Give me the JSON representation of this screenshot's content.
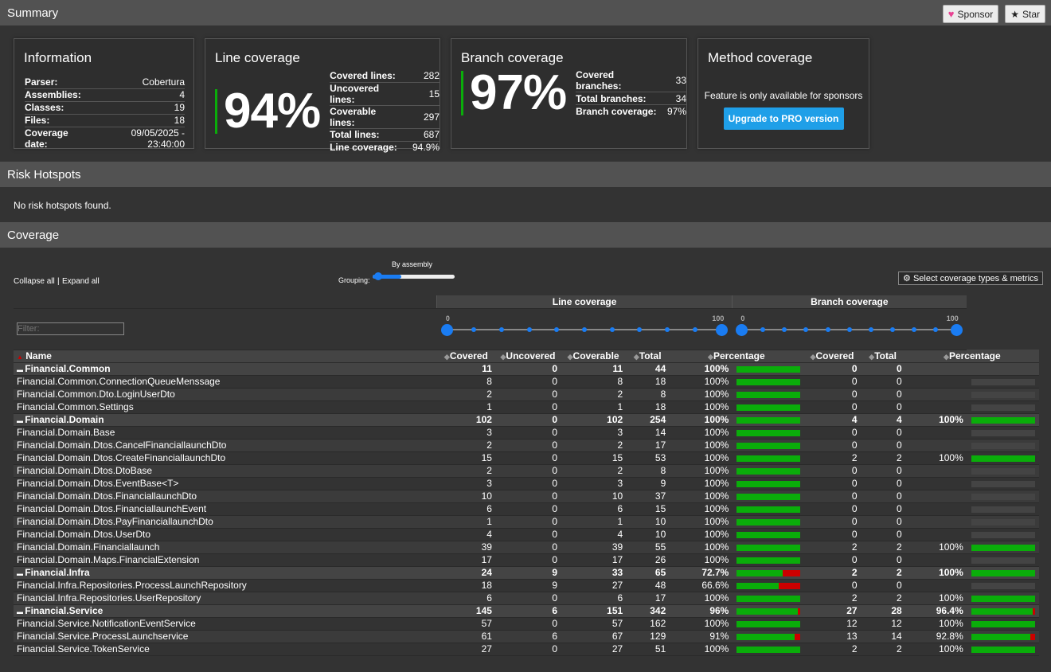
{
  "header": {
    "title": "Summary",
    "sponsor": "Sponsor",
    "star": "Star"
  },
  "information": {
    "title": "Information",
    "rows": [
      {
        "k": "Parser:",
        "v": "Cobertura"
      },
      {
        "k": "Assemblies:",
        "v": "4"
      },
      {
        "k": "Classes:",
        "v": "19"
      },
      {
        "k": "Files:",
        "v": "18"
      },
      {
        "k": "Coverage date:",
        "v": "09/05/2025 - 23:40:00"
      }
    ]
  },
  "line": {
    "title": "Line coverage",
    "pct": "94%",
    "rows": [
      {
        "k": "Covered lines:",
        "v": "282"
      },
      {
        "k": "Uncovered lines:",
        "v": "15"
      },
      {
        "k": "Coverable lines:",
        "v": "297"
      },
      {
        "k": "Total lines:",
        "v": "687"
      },
      {
        "k": "Line coverage:",
        "v": "94.9%"
      }
    ]
  },
  "branch": {
    "title": "Branch coverage",
    "pct": "97%",
    "rows": [
      {
        "k": "Covered branches:",
        "v": "33"
      },
      {
        "k": "Total branches:",
        "v": "34"
      },
      {
        "k": "Branch coverage:",
        "v": "97%"
      }
    ]
  },
  "method": {
    "title": "Method coverage",
    "text": "Feature is only available for sponsors",
    "button": "Upgrade to PRO version"
  },
  "risk": {
    "title": "Risk Hotspots",
    "text": "No risk hotspots found."
  },
  "coverage": {
    "title": "Coverage",
    "collapse": "Collapse all",
    "sep": "|",
    "expand": "Expand all",
    "grouping_label": "Grouping:",
    "grouping_value": "By assembly",
    "select": "Select coverage types & metrics",
    "filter_placeholder": "Filter:",
    "line_header": "Line coverage",
    "branch_header": "Branch coverage",
    "slider_min": "0",
    "slider_max": "100",
    "cols": {
      "name": "Name",
      "covered": "Covered",
      "uncovered": "Uncovered",
      "coverable": "Coverable",
      "total": "Total",
      "percentage": "Percentage",
      "bcovered": "Covered",
      "btotal": "Total",
      "bpercentage": "Percentage"
    }
  },
  "rows": [
    {
      "g": true,
      "n": "Financial.Common",
      "cv": "11",
      "un": "0",
      "ca": "11",
      "t": "44",
      "p": "100%",
      "lp": 100,
      "bc": "0",
      "bt": "0",
      "bp": "",
      "bpv": null
    },
    {
      "n": "Financial.Common.ConnectionQueueMenssage",
      "cv": "8",
      "un": "0",
      "ca": "8",
      "t": "18",
      "p": "100%",
      "lp": 100,
      "bc": "0",
      "bt": "0",
      "bp": "",
      "bpv": null
    },
    {
      "n": "Financial.Common.Dto.LoginUserDto",
      "cv": "2",
      "un": "0",
      "ca": "2",
      "t": "8",
      "p": "100%",
      "lp": 100,
      "bc": "0",
      "bt": "0",
      "bp": "",
      "bpv": null
    },
    {
      "n": "Financial.Common.Settings",
      "cv": "1",
      "un": "0",
      "ca": "1",
      "t": "18",
      "p": "100%",
      "lp": 100,
      "bc": "0",
      "bt": "0",
      "bp": "",
      "bpv": null
    },
    {
      "g": true,
      "n": "Financial.Domain",
      "cv": "102",
      "un": "0",
      "ca": "102",
      "t": "254",
      "p": "100%",
      "lp": 100,
      "bc": "4",
      "bt": "4",
      "bp": "100%",
      "bpv": 100
    },
    {
      "n": "Financial.Domain.Base",
      "cv": "3",
      "un": "0",
      "ca": "3",
      "t": "14",
      "p": "100%",
      "lp": 100,
      "bc": "0",
      "bt": "0",
      "bp": "",
      "bpv": null
    },
    {
      "n": "Financial.Domain.Dtos.CancelFinanciallaunchDto",
      "cv": "2",
      "un": "0",
      "ca": "2",
      "t": "17",
      "p": "100%",
      "lp": 100,
      "bc": "0",
      "bt": "0",
      "bp": "",
      "bpv": null
    },
    {
      "n": "Financial.Domain.Dtos.CreateFinanciallaunchDto",
      "cv": "15",
      "un": "0",
      "ca": "15",
      "t": "53",
      "p": "100%",
      "lp": 100,
      "bc": "2",
      "bt": "2",
      "bp": "100%",
      "bpv": 100
    },
    {
      "n": "Financial.Domain.Dtos.DtoBase",
      "cv": "2",
      "un": "0",
      "ca": "2",
      "t": "8",
      "p": "100%",
      "lp": 100,
      "bc": "0",
      "bt": "0",
      "bp": "",
      "bpv": null
    },
    {
      "n": "Financial.Domain.Dtos.EventBase<T>",
      "cv": "3",
      "un": "0",
      "ca": "3",
      "t": "9",
      "p": "100%",
      "lp": 100,
      "bc": "0",
      "bt": "0",
      "bp": "",
      "bpv": null
    },
    {
      "n": "Financial.Domain.Dtos.FinanciallaunchDto",
      "cv": "10",
      "un": "0",
      "ca": "10",
      "t": "37",
      "p": "100%",
      "lp": 100,
      "bc": "0",
      "bt": "0",
      "bp": "",
      "bpv": null
    },
    {
      "n": "Financial.Domain.Dtos.FinanciallaunchEvent",
      "cv": "6",
      "un": "0",
      "ca": "6",
      "t": "15",
      "p": "100%",
      "lp": 100,
      "bc": "0",
      "bt": "0",
      "bp": "",
      "bpv": null
    },
    {
      "n": "Financial.Domain.Dtos.PayFinanciallaunchDto",
      "cv": "1",
      "un": "0",
      "ca": "1",
      "t": "10",
      "p": "100%",
      "lp": 100,
      "bc": "0",
      "bt": "0",
      "bp": "",
      "bpv": null
    },
    {
      "n": "Financial.Domain.Dtos.UserDto",
      "cv": "4",
      "un": "0",
      "ca": "4",
      "t": "10",
      "p": "100%",
      "lp": 100,
      "bc": "0",
      "bt": "0",
      "bp": "",
      "bpv": null
    },
    {
      "n": "Financial.Domain.Financiallaunch",
      "cv": "39",
      "un": "0",
      "ca": "39",
      "t": "55",
      "p": "100%",
      "lp": 100,
      "bc": "2",
      "bt": "2",
      "bp": "100%",
      "bpv": 100
    },
    {
      "n": "Financial.Domain.Maps.FinancialExtension",
      "cv": "17",
      "un": "0",
      "ca": "17",
      "t": "26",
      "p": "100%",
      "lp": 100,
      "bc": "0",
      "bt": "0",
      "bp": "",
      "bpv": null
    },
    {
      "g": true,
      "n": "Financial.Infra",
      "cv": "24",
      "un": "9",
      "ca": "33",
      "t": "65",
      "p": "72.7%",
      "lp": 72.7,
      "bc": "2",
      "bt": "2",
      "bp": "100%",
      "bpv": 100
    },
    {
      "n": "Financial.Infra.Repositories.ProcessLaunchRepository",
      "cv": "18",
      "un": "9",
      "ca": "27",
      "t": "48",
      "p": "66.6%",
      "lp": 66.6,
      "bc": "0",
      "bt": "0",
      "bp": "",
      "bpv": null
    },
    {
      "n": "Financial.Infra.Repositories.UserRepository",
      "cv": "6",
      "un": "0",
      "ca": "6",
      "t": "17",
      "p": "100%",
      "lp": 100,
      "bc": "2",
      "bt": "2",
      "bp": "100%",
      "bpv": 100
    },
    {
      "g": true,
      "n": "Financial.Service",
      "cv": "145",
      "un": "6",
      "ca": "151",
      "t": "342",
      "p": "96%",
      "lp": 96,
      "bc": "27",
      "bt": "28",
      "bp": "96.4%",
      "bpv": 96.4
    },
    {
      "n": "Financial.Service.NotificationEventService",
      "cv": "57",
      "un": "0",
      "ca": "57",
      "t": "162",
      "p": "100%",
      "lp": 100,
      "bc": "12",
      "bt": "12",
      "bp": "100%",
      "bpv": 100
    },
    {
      "n": "Financial.Service.ProcessLaunchservice",
      "cv": "61",
      "un": "6",
      "ca": "67",
      "t": "129",
      "p": "91%",
      "lp": 91,
      "bc": "13",
      "bt": "14",
      "bp": "92.8%",
      "bpv": 92.8
    },
    {
      "n": "Financial.Service.TokenService",
      "cv": "27",
      "un": "0",
      "ca": "27",
      "t": "51",
      "p": "100%",
      "lp": 100,
      "bc": "2",
      "bt": "2",
      "bp": "100%",
      "bpv": 100
    }
  ]
}
